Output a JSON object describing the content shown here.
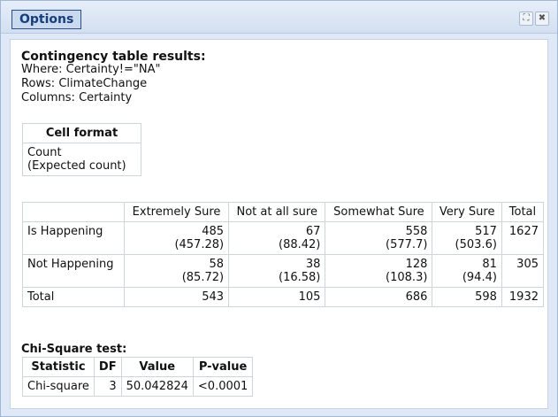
{
  "window": {
    "title": "Options",
    "controls": {
      "restore_icon": "restore-icon",
      "close_icon": "close-icon",
      "restore_glyph": "⛶",
      "close_glyph": "✖"
    }
  },
  "results": {
    "heading": "Contingency table results:",
    "where": "Where: Certainty!=\"NA\"",
    "rows": "Rows: ClimateChange",
    "columns": "Columns: Certainty"
  },
  "cell_format": {
    "header": "Cell format",
    "line1": "Count",
    "line2": "(Expected count)"
  },
  "contingency": {
    "columns": [
      "",
      "Extremely Sure",
      "Not at all sure",
      "Somewhat Sure",
      "Very Sure",
      "Total"
    ],
    "rows": [
      {
        "label": "Is Happening",
        "cells": [
          [
            "485",
            "(457.28)"
          ],
          [
            "67",
            "(88.42)"
          ],
          [
            "558",
            "(577.7)"
          ],
          [
            "517",
            "(503.6)"
          ]
        ],
        "total": "1627"
      },
      {
        "label": "Not Happening",
        "cells": [
          [
            "58",
            "(85.72)"
          ],
          [
            "38",
            "(16.58)"
          ],
          [
            "128",
            "(108.3)"
          ],
          [
            "81",
            "(94.4)"
          ]
        ],
        "total": "305"
      },
      {
        "label": "Total",
        "cells": [
          [
            "543",
            ""
          ],
          [
            "105",
            ""
          ],
          [
            "686",
            ""
          ],
          [
            "598",
            ""
          ]
        ],
        "total": "1932"
      }
    ]
  },
  "chi_square": {
    "heading": "Chi-Square test:",
    "columns": [
      "Statistic",
      "DF",
      "Value",
      "P-value"
    ],
    "row": {
      "statistic": "Chi-square",
      "df": "3",
      "value": "50.042824",
      "p_value": "<0.0001"
    }
  }
}
